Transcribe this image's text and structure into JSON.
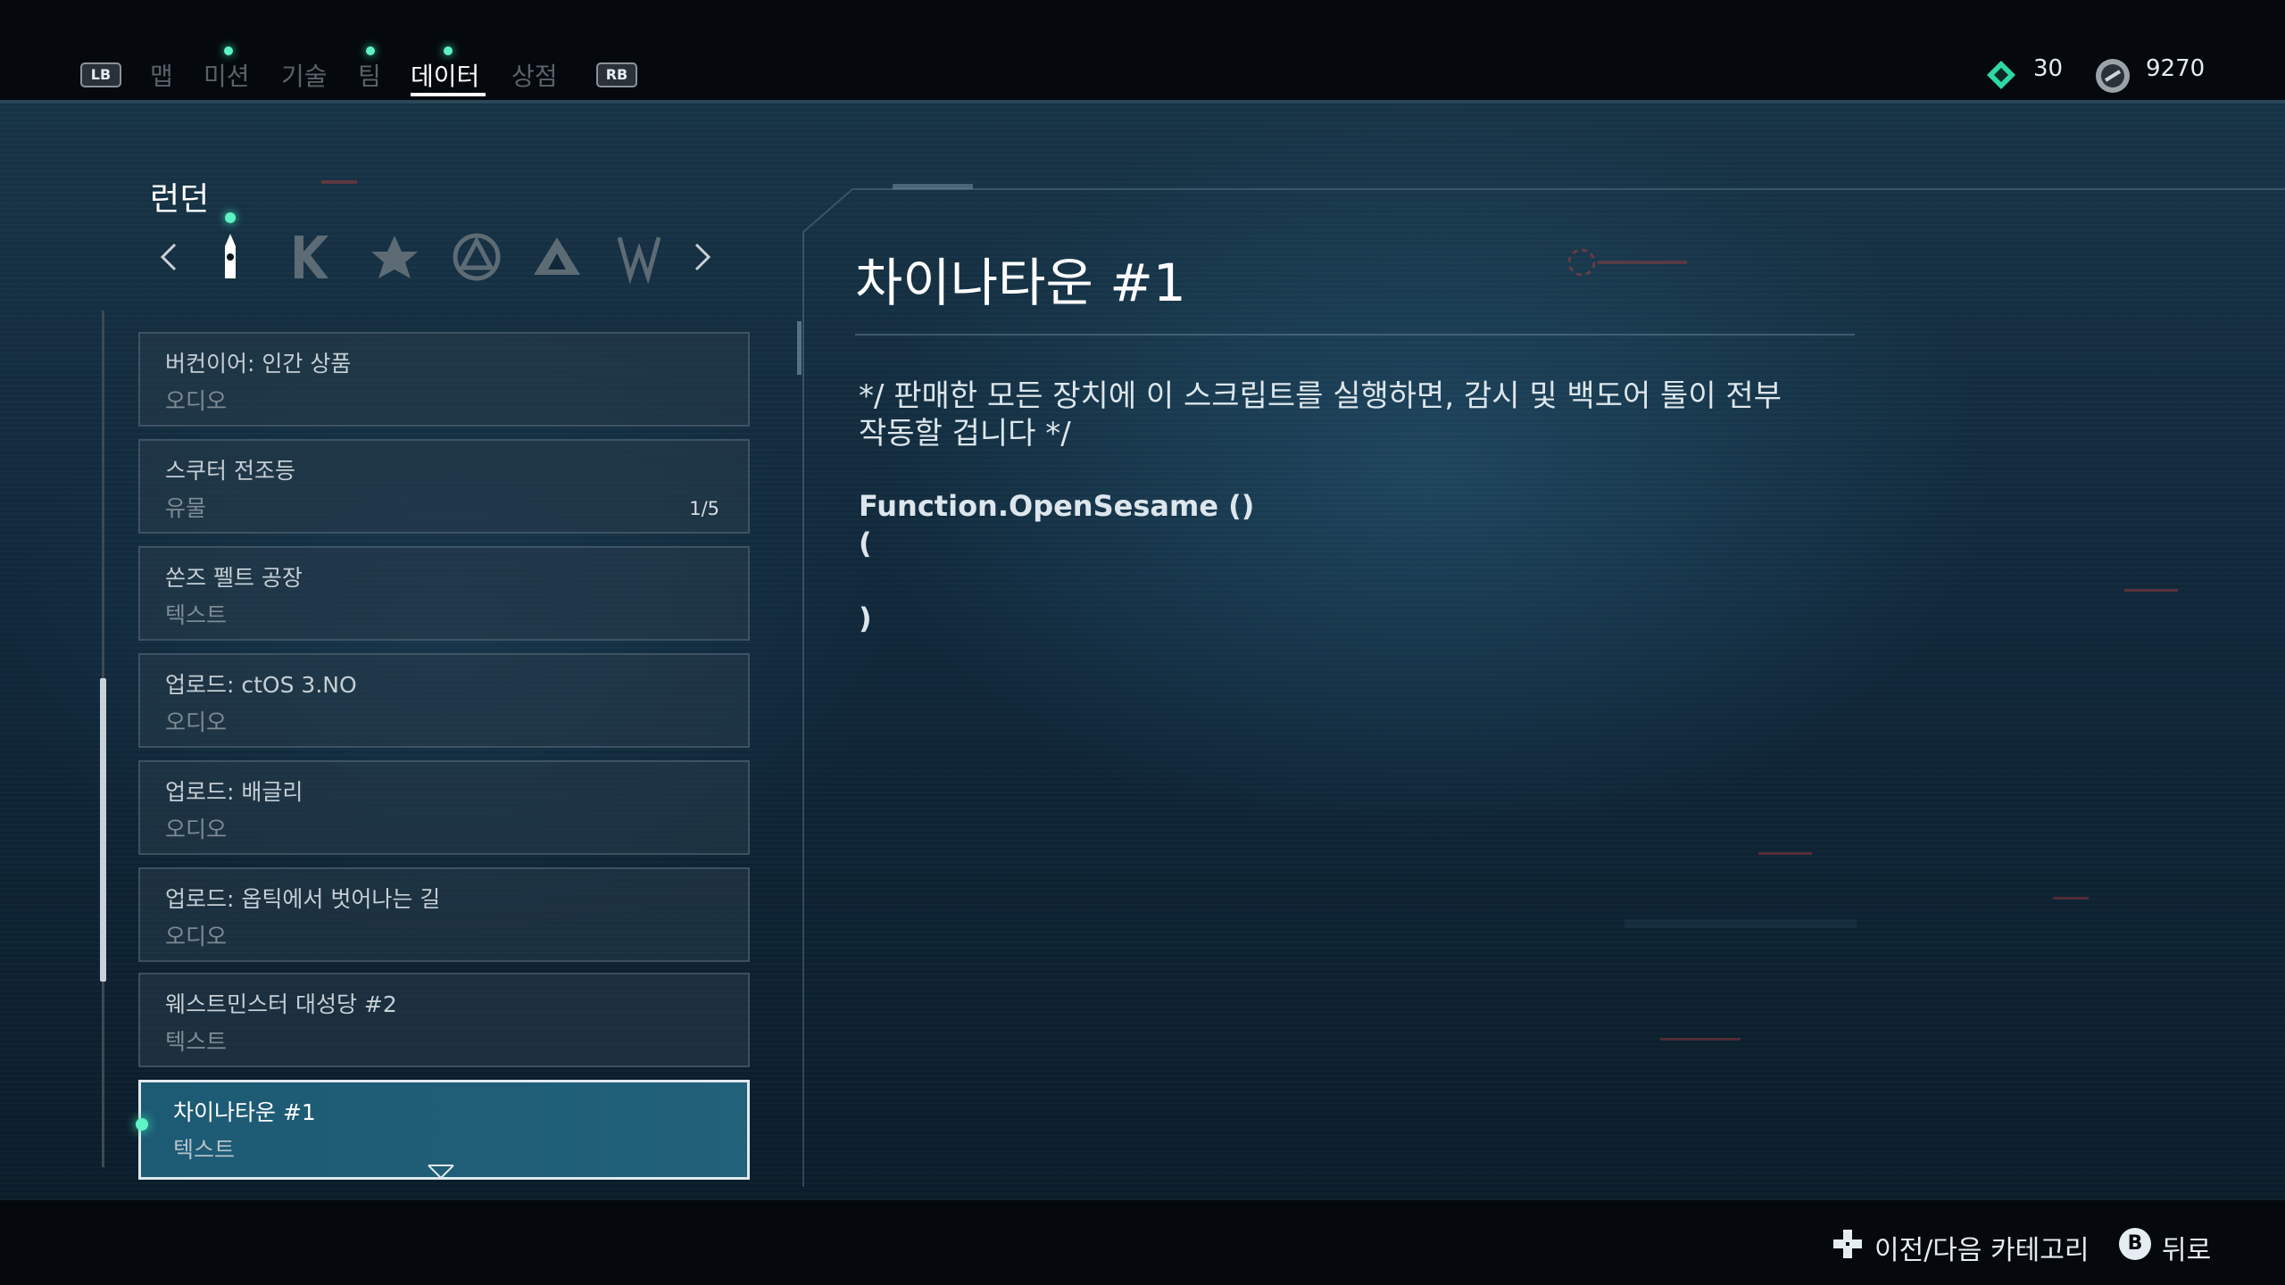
{
  "top_nav": {
    "left_bumper": "LB",
    "right_bumper": "RB",
    "tabs": [
      {
        "label": "맵",
        "has_dot": false
      },
      {
        "label": "미션",
        "has_dot": true
      },
      {
        "label": "기술",
        "has_dot": false
      },
      {
        "label": "팀",
        "has_dot": true
      },
      {
        "label": "데이터",
        "has_dot": true,
        "active": true
      },
      {
        "label": "상점",
        "has_dot": false
      }
    ]
  },
  "currency": {
    "tech_points": "30",
    "eto": "9270",
    "tech_icon": "diamond-icon",
    "eto_icon": "coin-icon"
  },
  "region": {
    "name": "런던",
    "categories": [
      "big-ben-icon",
      "kelley-k-icon",
      "albion-icon",
      "sirs-icon",
      "clan-kelley-icon",
      "dedsec-icon"
    ]
  },
  "list": {
    "items": [
      {
        "title": "버컨이어: 인간 상품",
        "subtitle": "오디오",
        "count": ""
      },
      {
        "title": "스쿠터 전조등",
        "subtitle": "유물",
        "count": "1/5"
      },
      {
        "title": "쏜즈 펠트 공장",
        "subtitle": "텍스트",
        "count": ""
      },
      {
        "title": "업로드: ctOS 3.NO",
        "subtitle": "오디오",
        "count": ""
      },
      {
        "title": "업로드: 배글리",
        "subtitle": "오디오",
        "count": ""
      },
      {
        "title": "업로드: 옵틱에서 벗어나는 길",
        "subtitle": "오디오",
        "count": ""
      },
      {
        "title": "웨스트민스터 대성당 #2",
        "subtitle": "텍스트",
        "count": ""
      },
      {
        "title": "차이나타운 #1",
        "subtitle": "텍스트",
        "count": "",
        "selected": true
      }
    ]
  },
  "detail": {
    "title": "차이나타운 #1",
    "body_line1": "*/ 판매한 모든 장치에 이 스크립트를 실행하면, 감시 및 백도어 툴이 전부",
    "body_line2": "작동할 겁니다 */",
    "code_line1": "Function.OpenSesame ()",
    "code_line2": "(",
    "code_line3": ")"
  },
  "footer": {
    "prev_next_label": "이전/다음 카테고리",
    "back_button_glyph": "B",
    "back_label": "뒤로",
    "dpad_icon": "dpad-icon"
  }
}
